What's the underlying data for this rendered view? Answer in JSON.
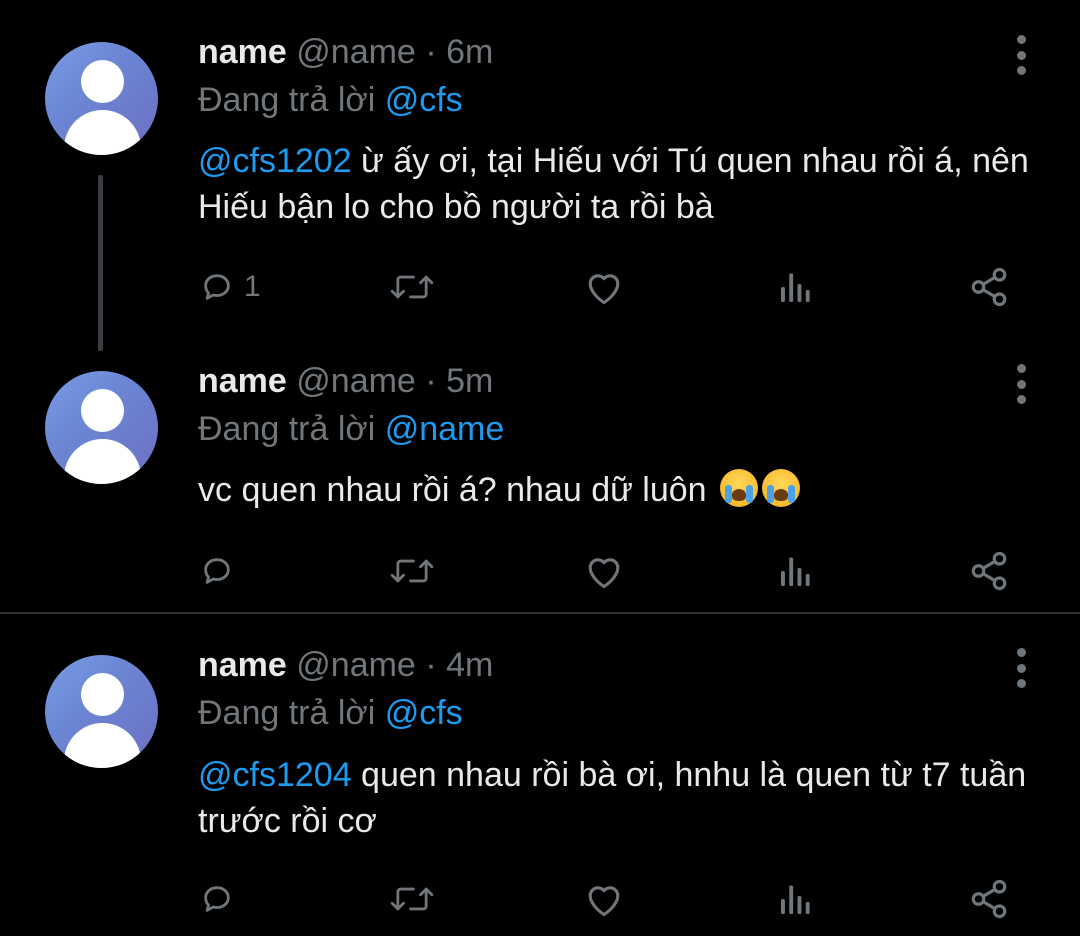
{
  "colors": {
    "background": "#000000",
    "text": "#e7e9ea",
    "secondary": "#71767b",
    "mention": "#1d9bf0",
    "divider": "#2f3336"
  },
  "tweets": [
    {
      "name": "name",
      "handle": "@name",
      "dot": "·",
      "time": "6m",
      "replying_prefix": "Đang trả lời",
      "replying_to": "@cfs",
      "body_mention": "@cfs1202",
      "body_text": " ừ ấy ơi, tại Hiếu với Tú quen nhau rồi á, nên Hiếu bận lo cho bồ người ta rồi bà",
      "reply_count": "1",
      "icons": [
        "reply-icon",
        "retweet-icon",
        "like-icon",
        "views-icon",
        "share-icon"
      ]
    },
    {
      "name": "name",
      "handle": "@name",
      "dot": "·",
      "time": "5m",
      "replying_prefix": "Đang trả lời",
      "replying_to": "@name",
      "body_mention": "",
      "body_text": "vc quen nhau rồi á? nhau dữ luôn",
      "emoji": [
        "loudly-crying-face",
        "loudly-crying-face"
      ],
      "reply_count": "",
      "icons": [
        "reply-icon",
        "retweet-icon",
        "like-icon",
        "views-icon",
        "share-icon"
      ]
    },
    {
      "name": "name",
      "handle": "@name",
      "dot": "·",
      "time": "4m",
      "replying_prefix": "Đang trả lời",
      "replying_to": "@cfs",
      "body_mention": "@cfs1204",
      "body_text": " quen nhau rồi bà ơi, hnhu là quen từ t7 tuần trước rồi cơ",
      "reply_count": "",
      "icons": [
        "reply-icon",
        "retweet-icon",
        "like-icon",
        "views-icon",
        "share-icon"
      ]
    }
  ]
}
